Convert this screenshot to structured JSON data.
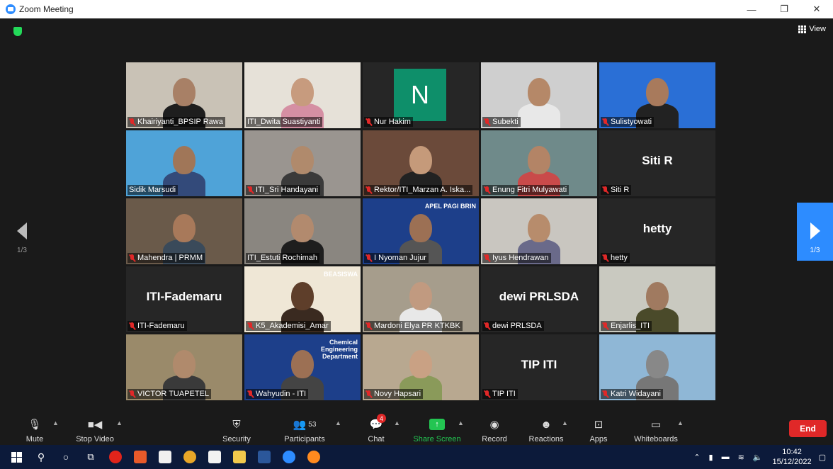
{
  "window": {
    "title": "Zoom Meeting",
    "minimize": "—",
    "maximize": "❐",
    "close": "✕"
  },
  "meeting": {
    "view_label": "View",
    "page_left": "1/3",
    "page_right": "1/3"
  },
  "participants_grid": [
    {
      "name": "Khairiyanti_BPSIP Rawa",
      "muted": true,
      "type": "video",
      "bg": "#c9c2b6",
      "face": "#a88066",
      "cloth": "#1e1e1e"
    },
    {
      "name": "ITI_Dwita Suastiyanti",
      "muted": false,
      "type": "video",
      "bg": "#e6e1d8",
      "face": "#c79b7e",
      "cloth": "#d58fa3",
      "active": true
    },
    {
      "name": "Nur Hakim",
      "muted": true,
      "type": "avatar",
      "avatar_letter": "N"
    },
    {
      "name": "Subekti",
      "muted": true,
      "type": "video",
      "bg": "#cfcfcf",
      "face": "#b58868",
      "cloth": "#e8e8e8"
    },
    {
      "name": "Sulistyowati",
      "muted": true,
      "type": "video",
      "bg": "#2a6fd6",
      "face": "#a87a5c",
      "cloth": "#222"
    },
    {
      "name": "Sidik Marsudi",
      "muted": false,
      "type": "video",
      "bg": "#4fa3d8",
      "face": "#a07658",
      "cloth": "#334a7a"
    },
    {
      "name": "ITI_Sri Handayani",
      "muted": true,
      "type": "video",
      "bg": "#9a9590",
      "face": "#b08a6c",
      "cloth": "#3a3a3a"
    },
    {
      "name": "Rektor/ITI_Marzan A. Iska...",
      "muted": true,
      "type": "video",
      "bg": "#6b4a3a",
      "face": "#c59a7a",
      "cloth": "#222"
    },
    {
      "name": "Enung Fitri Mulyawati",
      "muted": true,
      "type": "video",
      "bg": "#6f8a8a",
      "face": "#b38466",
      "cloth": "#c94a4a"
    },
    {
      "name": "Siti R",
      "muted": true,
      "type": "name",
      "display_name": "Siti R"
    },
    {
      "name": "Mahendra | PRMM",
      "muted": true,
      "type": "video",
      "bg": "#6a5a4a",
      "face": "#a8795a",
      "cloth": "#3a4a5a"
    },
    {
      "name": "ITI_Estuti Rochimah",
      "muted": false,
      "type": "video",
      "bg": "#8a8680",
      "face": "#b28a6e",
      "cloth": "#1e1e1e"
    },
    {
      "name": "I Nyoman Jujur",
      "muted": true,
      "type": "video",
      "bg": "#1d3f8a",
      "face": "#9c7054",
      "cloth": "#555",
      "overlay_text": "APEL PAGI BRIN"
    },
    {
      "name": "Iyus Hendrawan",
      "muted": true,
      "type": "video",
      "bg": "#c9c6c0",
      "face": "#b78c6c",
      "cloth": "#6a6a8a"
    },
    {
      "name": "hetty",
      "muted": true,
      "type": "name",
      "display_name": "hetty"
    },
    {
      "name": "ITI-Fademaru",
      "muted": true,
      "type": "name",
      "display_name": "ITI-Fademaru"
    },
    {
      "name": "K5_Akademisi_Amar",
      "muted": true,
      "type": "video",
      "bg": "#efe7d6",
      "face": "#5e3e2a",
      "cloth": "#3a2a20",
      "overlay_text": "BEASISWA"
    },
    {
      "name": "Mardoni Elya PR KTKBK",
      "muted": true,
      "type": "video",
      "bg": "#a69d8c",
      "face": "#c19a80",
      "cloth": "#e8e8e8"
    },
    {
      "name": "dewi PRLSDA",
      "muted": true,
      "type": "name",
      "display_name": "dewi PRLSDA"
    },
    {
      "name": "Enjarlis_ITI",
      "muted": true,
      "type": "video",
      "bg": "#c9c9c0",
      "face": "#a07a60",
      "cloth": "#4a4a2a"
    },
    {
      "name": "VICTOR TUAPETEL",
      "muted": true,
      "type": "video",
      "bg": "#9a8a6a",
      "face": "#b08a6c",
      "cloth": "#3a3a3a"
    },
    {
      "name": "Wahyudin - ITI",
      "muted": true,
      "type": "video",
      "bg": "#1d3f8a",
      "face": "#9c7054",
      "cloth": "#444",
      "overlay_text": "Chemical Engineering Department"
    },
    {
      "name": "Novy Hapsari",
      "muted": true,
      "type": "video",
      "bg": "#b8a890",
      "face": "#c9a184",
      "cloth": "#8a9a5a"
    },
    {
      "name": "TIP ITI",
      "muted": true,
      "type": "name",
      "display_name": "TIP ITI"
    },
    {
      "name": "Katri Widayani",
      "muted": true,
      "type": "video",
      "bg": "#8fb7d6",
      "face": "#888",
      "cloth": "#777"
    }
  ],
  "toolbar": {
    "mute": "Mute",
    "stop_video": "Stop Video",
    "security": "Security",
    "participants": "Participants",
    "participants_count": "53",
    "chat": "Chat",
    "chat_badge": "4",
    "share_screen": "Share Screen",
    "record": "Record",
    "reactions": "Reactions",
    "apps": "Apps",
    "whiteboards": "Whiteboards",
    "end": "End"
  },
  "taskbar": {
    "time": "10:42",
    "date": "15/12/2022"
  },
  "colors": {
    "zoom_blue": "#2d8cff",
    "end_red": "#e02828",
    "share_green": "#23c552",
    "active_speaker": "#c7e04b"
  }
}
